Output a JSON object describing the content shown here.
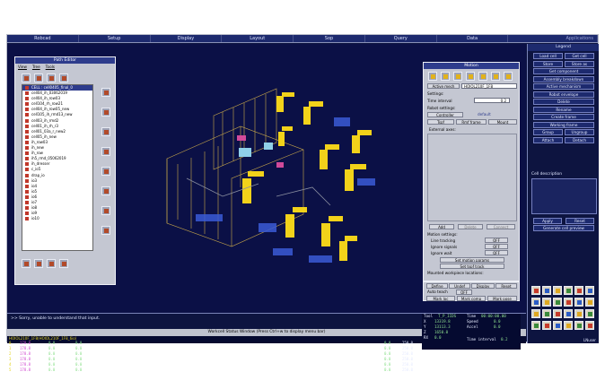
{
  "menu": [
    "Robcad",
    "Setup",
    "Display",
    "Layout",
    "Sop",
    "Query",
    "Data",
    "Applications"
  ],
  "path_editor": {
    "title": "Path Editor",
    "tabs": [
      "View",
      "Tree",
      "Tools"
    ],
    "items": [
      "CELL : cell0405_final_0",
      "cell04_ih_03062019",
      "cell04_ih_row03",
      "cell104_rh_row21",
      "cell04_ih_row05_new",
      "cell105_ih_rmd13_new",
      "cell03_ih_rmd2",
      "cell01_ih_rh_r3",
      "cell01_03a_r_new2",
      "cell05_ih_new",
      "ih_row03",
      "ih_new",
      "ih_row",
      "ih5_rmd_05062019",
      "ih_dresser",
      "c_io5",
      "drap_io",
      "io3",
      "io4",
      "io5",
      "io6",
      "io7",
      "io8",
      "io9",
      "io10"
    ]
  },
  "motion": {
    "title": "Motion",
    "active_mech_label": "Active mech",
    "active_mech_value": "HOIOL210F_1F8",
    "settings_label": "Settings:",
    "time_interval_label": "Time interval",
    "time_interval_value": "0.2",
    "robot_settings_label": "Robot settings:",
    "controller_label": "Controller",
    "controller_value": "default",
    "tabs": [
      "Tspf",
      "Rmf frame",
      "Mount"
    ],
    "external_axes_label": "External axes:",
    "add_label": "Add",
    "delete_label": "Delete",
    "connect_label": "Connect",
    "motion_settings_label": "Motion settings:",
    "line_tracking_label": "Line tracking",
    "line_tracking_value": "OFF",
    "ignore_signals_label": "Ignore signals",
    "ignore_signals_value": "OFF",
    "ignore_wait_label": "Ignore wait",
    "ignore_wait_value": "OFF",
    "set_motion_params": "Set motion params",
    "set_tspf_track": "Set tspf track",
    "mounted_label": "Mounted workpiece locations:",
    "bottom_buttons": [
      "Define",
      "Undef",
      "Display",
      "Reset"
    ],
    "auto_teach_label": "Auto teach",
    "auto_teach_value": "OFF",
    "mark_loc": "Mark loc",
    "mark_comp": "Mark comp",
    "mark_pose": "Mark pose"
  },
  "legend": {
    "title": "Legend",
    "buttons": [
      [
        "Load cell",
        "Get cell"
      ],
      [
        "Store",
        "Store as"
      ],
      [
        "Get component"
      ],
      [
        "Assembly breakdown"
      ],
      [
        "Active mechanism"
      ],
      [
        "Robot envelope"
      ],
      [
        "Delete"
      ],
      [
        "Rename"
      ],
      [
        "Create frame"
      ],
      [
        "Working frame"
      ],
      [
        "Group",
        "Ungroup"
      ],
      [
        "Attach",
        "Detach"
      ]
    ],
    "cell_description_label": "Cell description",
    "apply_label": "Apply",
    "reset_label": "Reset",
    "generate_preview": "Generate cell preview",
    "nuser_label": "LNuser"
  },
  "prompt_text": ">>  Sorry, unable to understand that input.",
  "status_window_title": "Workcell Status Window  (Press Ctrl+w to display menu bar)",
  "status": {
    "header_text": "HOIOL210F_1F8(HOIOL210F_1F8_6io)",
    "rows": [
      {
        "n": "0",
        "a": "178.8",
        "b": "0.0",
        "c": "0.0",
        "d": "0.0",
        "e": "250.0"
      },
      {
        "n": "1",
        "a": "178.8",
        "b": "0.0",
        "c": "0.0",
        "d": "0.0",
        "e": "250.0"
      },
      {
        "n": "2",
        "a": "178.8",
        "b": "0.0",
        "c": "0.0",
        "d": "0.0",
        "e": "250.0"
      },
      {
        "n": "3",
        "a": "178.8",
        "b": "0.0",
        "c": "0.0",
        "d": "0.0",
        "e": "250.0"
      },
      {
        "n": "4",
        "a": "178.8",
        "b": "0.0",
        "c": "0.0",
        "d": "0.0",
        "e": "250.0"
      },
      {
        "n": "5",
        "a": "178.8",
        "b": "0.0",
        "c": "0.0",
        "d": "0.0",
        "e": "250.0"
      }
    ],
    "tool_label": "Tool",
    "tool_value": "T_P_IIDS",
    "xyz": [
      [
        "X",
        "13319.8"
      ],
      [
        "Y",
        "13113.3"
      ],
      [
        "Z",
        "1650.0"
      ],
      [
        "RX",
        "0.0"
      ]
    ],
    "time_label": "Time",
    "time_value": "00:00:00.00",
    "speed_label": "Speed",
    "speed_value": "0.0",
    "accel_label": "Accel",
    "accel_value": "0.0",
    "time_interval_label": "Time interval",
    "time_interval_value": "0.2"
  },
  "colors": {
    "background": "#0b1046",
    "panel": "#c4c7d2",
    "title": "#2e3c8c",
    "robot": "#f2d21a"
  }
}
